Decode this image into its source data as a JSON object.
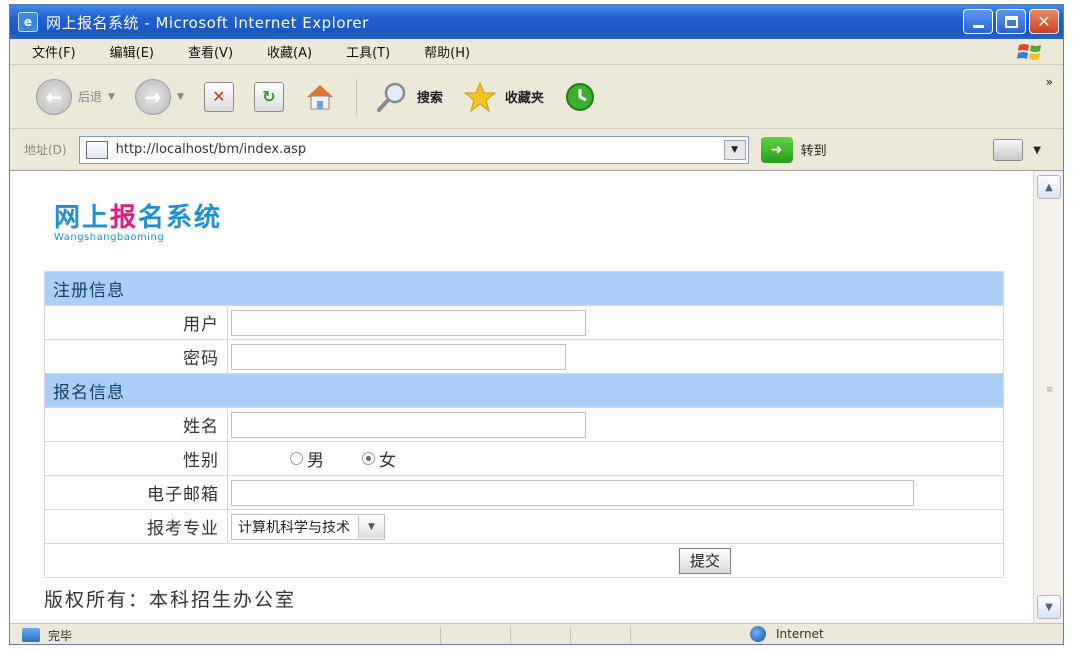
{
  "window": {
    "title": "网上报名系统 - Microsoft Internet Explorer"
  },
  "menu": [
    "文件(F)",
    "编辑(E)",
    "查看(V)",
    "收藏(A)",
    "工具(T)",
    "帮助(H)"
  ],
  "toolbar": {
    "back_label": "后退",
    "search_label": "搜索",
    "favorites_label": "收藏夹"
  },
  "address": {
    "label": "地址(D)",
    "url": "http://localhost/bm/index.asp",
    "go_label": "转到"
  },
  "logo": {
    "part1": "网上",
    "part2": "报",
    "part3": "名系统",
    "subtitle": "Wangshangbaoming"
  },
  "form": {
    "section1": "注册信息",
    "user_label": "用户",
    "user_value": "",
    "password_label": "密码",
    "password_value": "",
    "section2": "报名信息",
    "name_label": "姓名",
    "name_value": "",
    "gender_label": "性别",
    "gender_male": "男",
    "gender_female": "女",
    "gender_selected": "女",
    "email_label": "电子邮箱",
    "email_value": "",
    "major_label": "报考专业",
    "major_selected": "计算机科学与技术",
    "submit_label": "提交"
  },
  "footer": {
    "text": "版权所有：本科招生办公室"
  },
  "status": {
    "text": "完毕",
    "zone": "Internet"
  },
  "colors": {
    "titlebar": "#1f5fcf",
    "section_header": "#a9cff7",
    "logo_blue": "#1c8fd6",
    "logo_pink": "#e5197c"
  }
}
